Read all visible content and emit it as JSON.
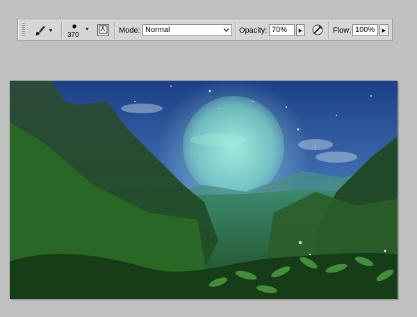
{
  "tool": {
    "name_icon": "brush-icon"
  },
  "brush": {
    "size": "370"
  },
  "mode": {
    "label": "Mode:",
    "value": "Normal"
  },
  "opacity": {
    "label": "Opacity:",
    "value": "70%"
  },
  "flow": {
    "label": "Flow:",
    "value": "100%"
  },
  "icons": {
    "preset_arrow": "triangle-down",
    "brush_panel": "brush-panel-icon",
    "airbrush": "airbrush-icon",
    "dropdown": "chevron-down-icon",
    "flyout": "triangle-right"
  },
  "colors": {
    "toolbar_bg": "#d6d6d6",
    "workspace_bg": "#c0c0c0",
    "moon_glow": "#8fe3d2"
  }
}
